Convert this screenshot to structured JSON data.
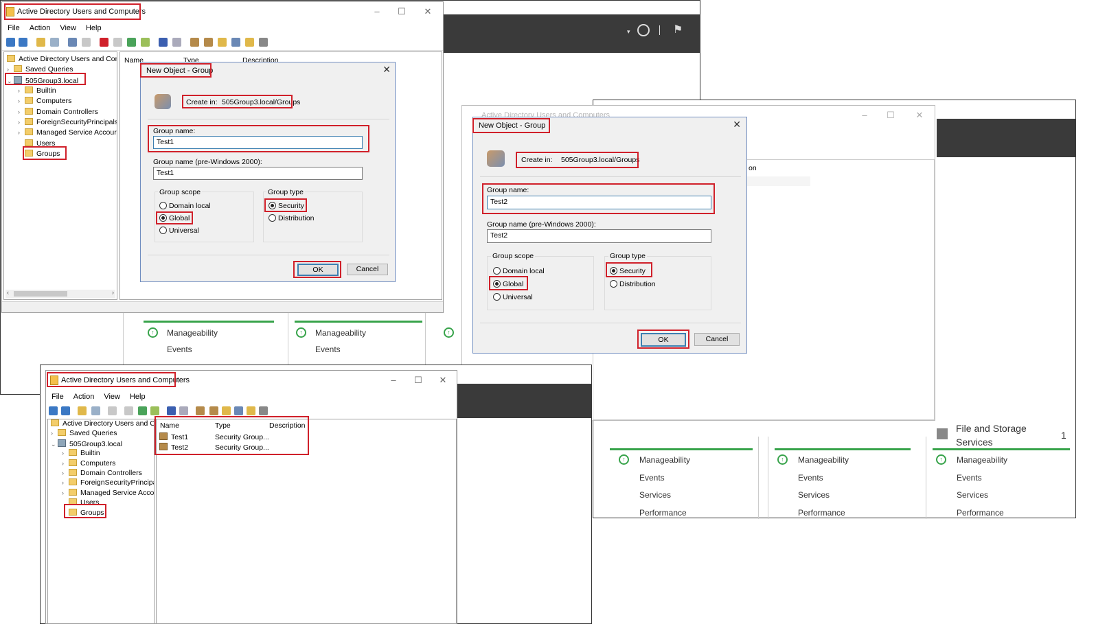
{
  "app_title": "Active Directory Users and Computers",
  "app_title_faded": "Active Directory Users and Computers",
  "menu": [
    "File",
    "Action",
    "View",
    "Help"
  ],
  "tree": {
    "root": "Active Directory Users and Com",
    "saved_queries": "Saved Queries",
    "domain": "505Group3.local",
    "children": [
      "Builtin",
      "Computers",
      "Domain Controllers",
      "ForeignSecurityPrincipals",
      "Managed Service Accour",
      "Users",
      "Groups"
    ]
  },
  "list_columns": [
    "Name",
    "Type",
    "Description"
  ],
  "list_rows": [
    {
      "name": "Test1",
      "type": "Security Group..."
    },
    {
      "name": "Test2",
      "type": "Security Group..."
    }
  ],
  "dialog1": {
    "title": "New Object - Group",
    "create_in_label": "Create in:",
    "create_in_value": "505Group3.local/Groups",
    "group_name_label": "Group name:",
    "group_name_value": "Test1",
    "pre2000_label": "Group name (pre-Windows 2000):",
    "pre2000_value": "Test1",
    "scope_label": "Group scope",
    "scope_options": [
      "Domain local",
      "Global",
      "Universal"
    ],
    "type_label": "Group type",
    "type_options": [
      "Security",
      "Distribution"
    ],
    "ok": "OK",
    "cancel": "Cancel"
  },
  "dialog2": {
    "title": "New Object - Group",
    "create_in_label": "Create in:",
    "create_in_value": "505Group3.local/Groups",
    "group_name_label": "Group name:",
    "group_name_value": "Test2",
    "pre2000_label": "Group name (pre-Windows 2000):",
    "pre2000_value": "Test2",
    "scope_label": "Group scope",
    "scope_options": [
      "Domain local",
      "Global",
      "Universal"
    ],
    "type_label": "Group type",
    "type_options": [
      "Security",
      "Distribution"
    ],
    "ok": "OK",
    "cancel": "Cancel"
  },
  "behind_fragment": "on",
  "tiles": {
    "items": [
      "Manageability",
      "Events",
      "Services",
      "Performance"
    ],
    "file_storage_title_1": "File and Storage",
    "file_storage_title_2": "Services",
    "file_storage_count": "1"
  },
  "colors": {
    "highlight": "#d0202a",
    "status_ok": "#37a34a",
    "dialog_bg": "#f0f0f0"
  }
}
